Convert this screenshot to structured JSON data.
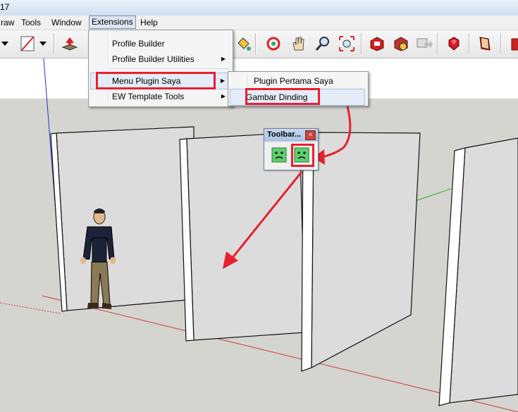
{
  "window": {
    "title_fragment": "17"
  },
  "menubar": {
    "items": [
      "raw",
      "Tools",
      "Window",
      "Extensions",
      "Help"
    ]
  },
  "extensions_menu": {
    "items": [
      {
        "label": "Profile Builder",
        "has_submenu": false
      },
      {
        "label": "Profile Builder Utilities",
        "has_submenu": true
      },
      {
        "label": "Menu Plugin Saya",
        "has_submenu": true
      },
      {
        "label": "EW Template Tools",
        "has_submenu": true
      }
    ]
  },
  "submenu": {
    "items": [
      {
        "label": "Plugin Pertama Saya"
      },
      {
        "label": "Gambar Dinding"
      }
    ]
  },
  "floating_toolbar": {
    "title": "Toolbar...",
    "close_glyph": "×"
  },
  "colors": {
    "highlight_red": "#e8202f",
    "ground": "#d4d4d0",
    "sky": "#ffffff",
    "wall": "#dcdcdc"
  }
}
